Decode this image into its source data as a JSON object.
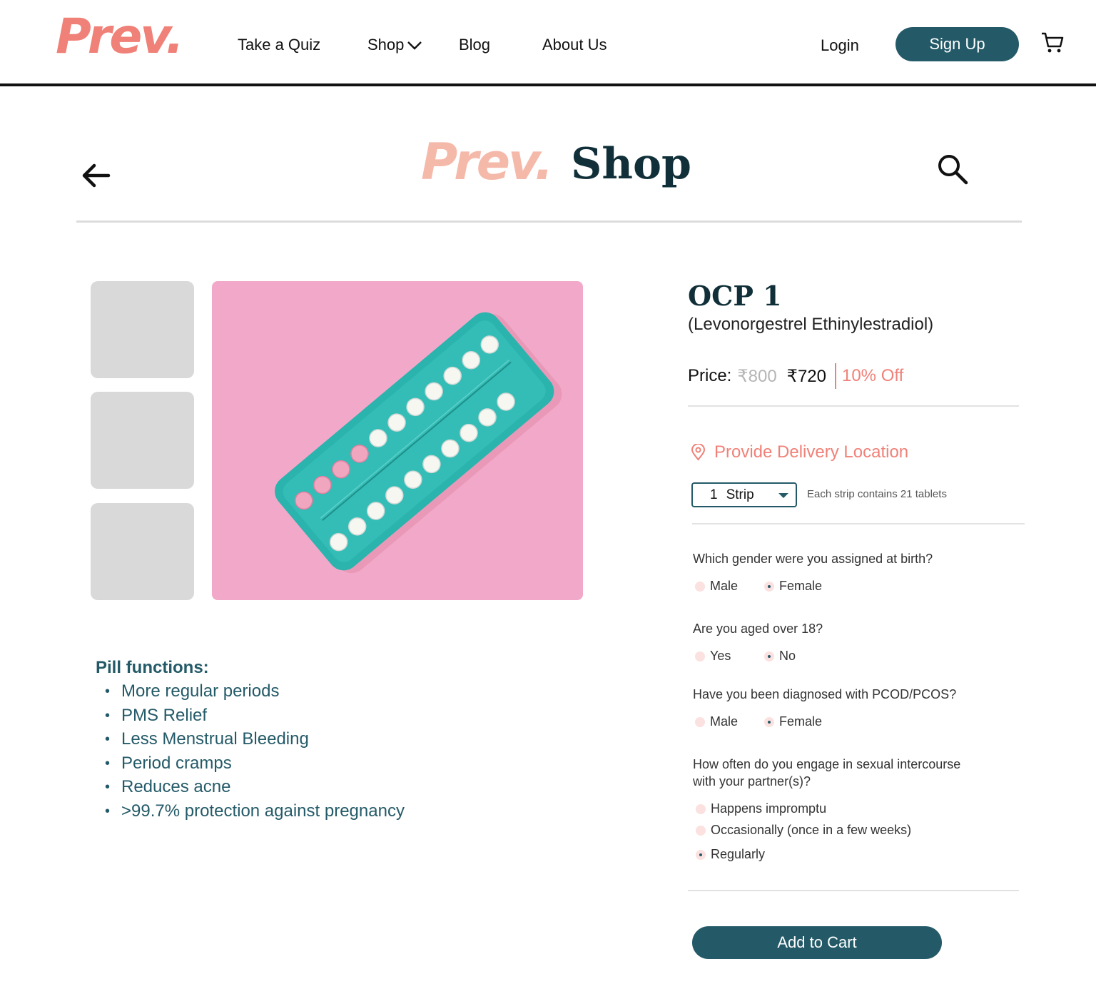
{
  "brand": {
    "logo_text": "Prev.",
    "accent_color": "#f08178",
    "primary_color": "#245a68"
  },
  "nav": {
    "links": [
      {
        "label": "Take a Quiz"
      },
      {
        "label": "Shop",
        "icon": "chevron-down-icon"
      },
      {
        "label": "Blog"
      },
      {
        "label": "About Us"
      }
    ],
    "login_label": "Login",
    "signup_label": "Sign Up",
    "cart_icon": "cart-icon"
  },
  "shop_header": {
    "logo_text": "Prev.",
    "title": "Shop",
    "back_icon": "arrow-left-icon",
    "search_icon": "search-icon"
  },
  "gallery": {
    "thumbnail_count": 3,
    "main_image": "contraceptive-pill-blister-pack"
  },
  "pill_functions": {
    "title": "Pill functions:",
    "items": [
      "More regular periods",
      "PMS Relief",
      "Less Menstrual Bleeding",
      "Period cramps",
      "Reduces acne",
      ">99.7% protection against pregnancy"
    ]
  },
  "product": {
    "name": "OCP 1",
    "subtitle": "(Levonorgestrel Ethinylestradiol)",
    "price_label": "Price:",
    "price_old": "₹800",
    "price_new": "₹720",
    "discount": "10% Off",
    "location_label": "Provide Delivery Location",
    "quantity": {
      "value": "1",
      "unit": "Strip"
    },
    "strip_note": "Each strip contains  21 tablets"
  },
  "questions": [
    {
      "text": "Which gender were you assigned at birth?",
      "options": [
        "Male",
        "Female"
      ],
      "selected": 1
    },
    {
      "text": "Are you aged over 18?",
      "options": [
        "Yes",
        "No"
      ],
      "selected": 1
    },
    {
      "text": "Have you been diagnosed with PCOD/PCOS?",
      "options": [
        "Male",
        "Female"
      ],
      "selected": 1
    },
    {
      "text": "How often do you engage in sexual intercourse",
      "text_line2": "with your partner(s)?",
      "options": [
        "Happens impromptu",
        "Occasionally (once in a few weeks)",
        "Regularly"
      ],
      "selected": 2
    }
  ],
  "add_to_cart_label": "Add to Cart"
}
